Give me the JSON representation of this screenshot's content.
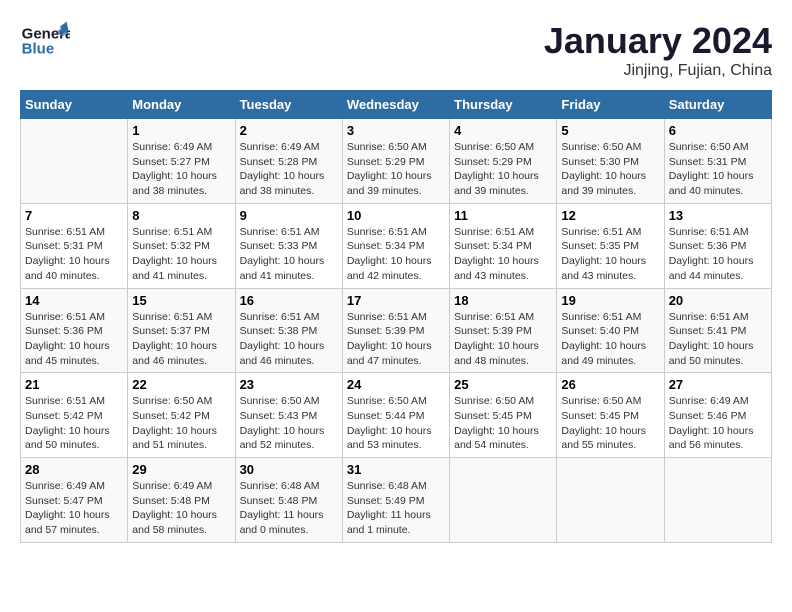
{
  "header": {
    "logo_general": "General",
    "logo_blue": "Blue",
    "month_title": "January 2024",
    "location": "Jinjing, Fujian, China"
  },
  "days_of_week": [
    "Sunday",
    "Monday",
    "Tuesday",
    "Wednesday",
    "Thursday",
    "Friday",
    "Saturday"
  ],
  "weeks": [
    [
      {
        "day": "",
        "info": ""
      },
      {
        "day": "1",
        "info": "Sunrise: 6:49 AM\nSunset: 5:27 PM\nDaylight: 10 hours\nand 38 minutes."
      },
      {
        "day": "2",
        "info": "Sunrise: 6:49 AM\nSunset: 5:28 PM\nDaylight: 10 hours\nand 38 minutes."
      },
      {
        "day": "3",
        "info": "Sunrise: 6:50 AM\nSunset: 5:29 PM\nDaylight: 10 hours\nand 39 minutes."
      },
      {
        "day": "4",
        "info": "Sunrise: 6:50 AM\nSunset: 5:29 PM\nDaylight: 10 hours\nand 39 minutes."
      },
      {
        "day": "5",
        "info": "Sunrise: 6:50 AM\nSunset: 5:30 PM\nDaylight: 10 hours\nand 39 minutes."
      },
      {
        "day": "6",
        "info": "Sunrise: 6:50 AM\nSunset: 5:31 PM\nDaylight: 10 hours\nand 40 minutes."
      }
    ],
    [
      {
        "day": "7",
        "info": "Sunrise: 6:51 AM\nSunset: 5:31 PM\nDaylight: 10 hours\nand 40 minutes."
      },
      {
        "day": "8",
        "info": "Sunrise: 6:51 AM\nSunset: 5:32 PM\nDaylight: 10 hours\nand 41 minutes."
      },
      {
        "day": "9",
        "info": "Sunrise: 6:51 AM\nSunset: 5:33 PM\nDaylight: 10 hours\nand 41 minutes."
      },
      {
        "day": "10",
        "info": "Sunrise: 6:51 AM\nSunset: 5:34 PM\nDaylight: 10 hours\nand 42 minutes."
      },
      {
        "day": "11",
        "info": "Sunrise: 6:51 AM\nSunset: 5:34 PM\nDaylight: 10 hours\nand 43 minutes."
      },
      {
        "day": "12",
        "info": "Sunrise: 6:51 AM\nSunset: 5:35 PM\nDaylight: 10 hours\nand 43 minutes."
      },
      {
        "day": "13",
        "info": "Sunrise: 6:51 AM\nSunset: 5:36 PM\nDaylight: 10 hours\nand 44 minutes."
      }
    ],
    [
      {
        "day": "14",
        "info": "Sunrise: 6:51 AM\nSunset: 5:36 PM\nDaylight: 10 hours\nand 45 minutes."
      },
      {
        "day": "15",
        "info": "Sunrise: 6:51 AM\nSunset: 5:37 PM\nDaylight: 10 hours\nand 46 minutes."
      },
      {
        "day": "16",
        "info": "Sunrise: 6:51 AM\nSunset: 5:38 PM\nDaylight: 10 hours\nand 46 minutes."
      },
      {
        "day": "17",
        "info": "Sunrise: 6:51 AM\nSunset: 5:39 PM\nDaylight: 10 hours\nand 47 minutes."
      },
      {
        "day": "18",
        "info": "Sunrise: 6:51 AM\nSunset: 5:39 PM\nDaylight: 10 hours\nand 48 minutes."
      },
      {
        "day": "19",
        "info": "Sunrise: 6:51 AM\nSunset: 5:40 PM\nDaylight: 10 hours\nand 49 minutes."
      },
      {
        "day": "20",
        "info": "Sunrise: 6:51 AM\nSunset: 5:41 PM\nDaylight: 10 hours\nand 50 minutes."
      }
    ],
    [
      {
        "day": "21",
        "info": "Sunrise: 6:51 AM\nSunset: 5:42 PM\nDaylight: 10 hours\nand 50 minutes."
      },
      {
        "day": "22",
        "info": "Sunrise: 6:50 AM\nSunset: 5:42 PM\nDaylight: 10 hours\nand 51 minutes."
      },
      {
        "day": "23",
        "info": "Sunrise: 6:50 AM\nSunset: 5:43 PM\nDaylight: 10 hours\nand 52 minutes."
      },
      {
        "day": "24",
        "info": "Sunrise: 6:50 AM\nSunset: 5:44 PM\nDaylight: 10 hours\nand 53 minutes."
      },
      {
        "day": "25",
        "info": "Sunrise: 6:50 AM\nSunset: 5:45 PM\nDaylight: 10 hours\nand 54 minutes."
      },
      {
        "day": "26",
        "info": "Sunrise: 6:50 AM\nSunset: 5:45 PM\nDaylight: 10 hours\nand 55 minutes."
      },
      {
        "day": "27",
        "info": "Sunrise: 6:49 AM\nSunset: 5:46 PM\nDaylight: 10 hours\nand 56 minutes."
      }
    ],
    [
      {
        "day": "28",
        "info": "Sunrise: 6:49 AM\nSunset: 5:47 PM\nDaylight: 10 hours\nand 57 minutes."
      },
      {
        "day": "29",
        "info": "Sunrise: 6:49 AM\nSunset: 5:48 PM\nDaylight: 10 hours\nand 58 minutes."
      },
      {
        "day": "30",
        "info": "Sunrise: 6:48 AM\nSunset: 5:48 PM\nDaylight: 11 hours\nand 0 minutes."
      },
      {
        "day": "31",
        "info": "Sunrise: 6:48 AM\nSunset: 5:49 PM\nDaylight: 11 hours\nand 1 minute."
      },
      {
        "day": "",
        "info": ""
      },
      {
        "day": "",
        "info": ""
      },
      {
        "day": "",
        "info": ""
      }
    ]
  ]
}
